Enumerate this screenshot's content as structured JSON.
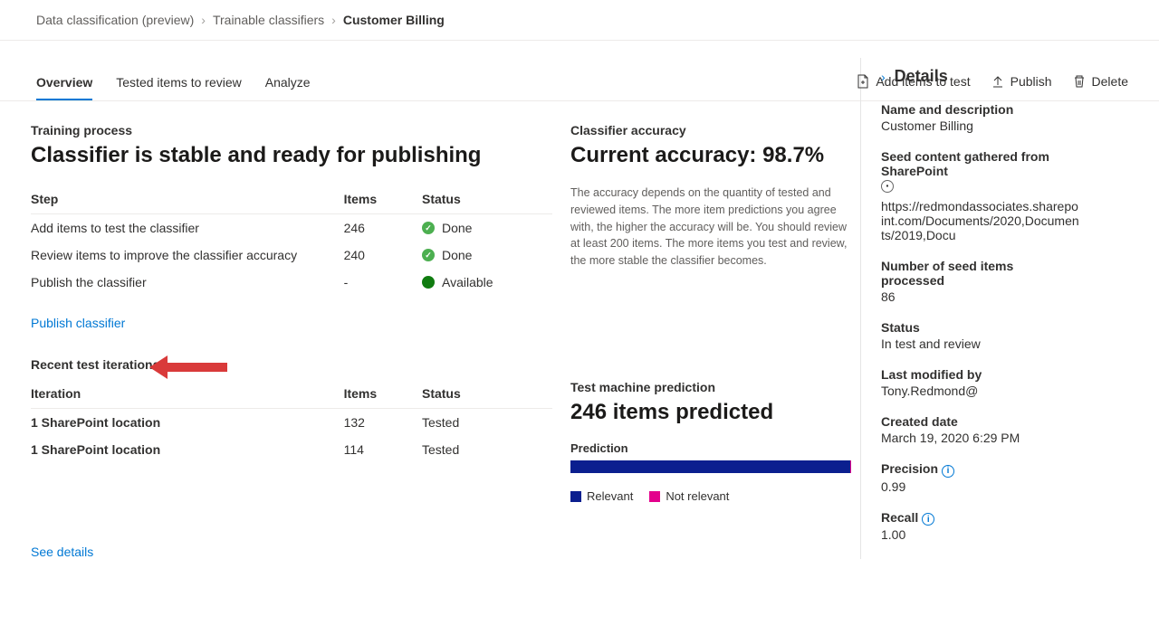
{
  "breadcrumb": {
    "item1": "Data classification (preview)",
    "item2": "Trainable classifiers",
    "item3": "Customer Billing"
  },
  "actions": {
    "add": "Add items to test",
    "publish": "Publish",
    "delete": "Delete"
  },
  "tabs": {
    "overview": "Overview",
    "tested": "Tested items to review",
    "analyze": "Analyze"
  },
  "training": {
    "label": "Training process",
    "headline": "Classifier is stable and ready for publishing",
    "col_step": "Step",
    "col_items": "Items",
    "col_status": "Status",
    "rows": [
      {
        "step": "Add items to test the classifier",
        "items": "246",
        "status": "Done",
        "kind": "done"
      },
      {
        "step": "Review items to improve the classifier accuracy",
        "items": "240",
        "status": "Done",
        "kind": "done"
      },
      {
        "step": "Publish the classifier",
        "items": "-",
        "status": "Available",
        "kind": "avail"
      }
    ],
    "publish_link": "Publish classifier"
  },
  "iterations": {
    "label": "Recent test iterations",
    "col_iter": "Iteration",
    "col_items": "Items",
    "col_status": "Status",
    "rows": [
      {
        "iter": "1 SharePoint location",
        "items": "132",
        "status": "Tested"
      },
      {
        "iter": "1 SharePoint location",
        "items": "114",
        "status": "Tested"
      }
    ],
    "see_details": "See details"
  },
  "accuracy": {
    "label": "Classifier accuracy",
    "headline": "Current accuracy: 98.7%",
    "desc": "The accuracy depends on the quantity of tested and reviewed items. The more item predictions you agree with, the higher the accuracy will be. You should review at least 200 items. The more items you test and review, the more stable the classifier becomes."
  },
  "prediction": {
    "label": "Test machine prediction",
    "headline": "246 items predicted",
    "sub": "Prediction",
    "legend_relevant": "Relevant",
    "legend_not_relevant": "Not relevant"
  },
  "details": {
    "title": "Details",
    "name_label": "Name and description",
    "name_value": "Customer Billing",
    "seed_label": "Seed content gathered from SharePoint",
    "seed_value": "https://redmondassociates.sharepoint.com/Documents/2020,Documents/2019,Docu",
    "count_label": "Number of seed items processed",
    "count_value": "86",
    "status_label": "Status",
    "status_value": "In test and review",
    "modified_label": "Last modified by",
    "modified_value": "Tony.Redmond@",
    "created_label": "Created date",
    "created_value": "March 19, 2020 6:29 PM",
    "precision_label": "Precision",
    "precision_value": "0.99",
    "recall_label": "Recall",
    "recall_value": "1.00"
  }
}
